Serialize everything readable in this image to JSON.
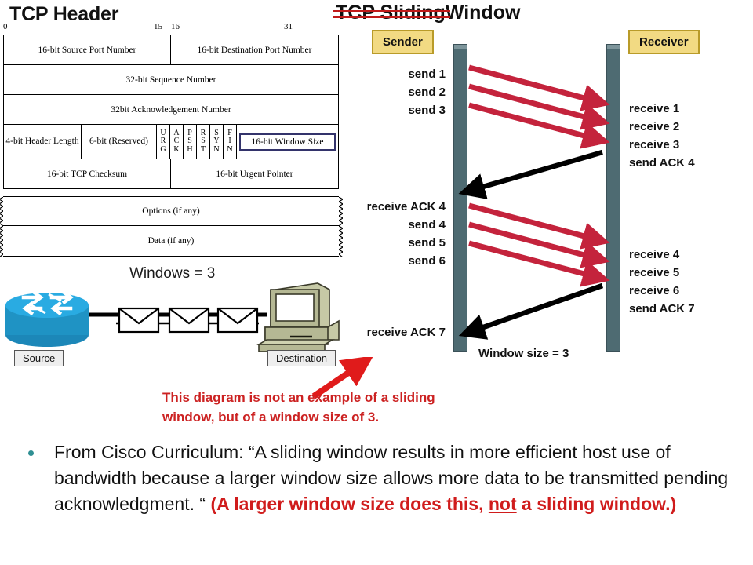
{
  "slide": {
    "left_title": "TCP Header",
    "right_title_struck": "TCP Sliding",
    "right_title_plain": "Window"
  },
  "tcp_header": {
    "bit_marks": [
      "0",
      "15",
      "16",
      "31"
    ],
    "rows": {
      "source_port": "16-bit Source Port Number",
      "dest_port": "16-bit Destination Port Number",
      "sequence": "32-bit Sequence Number",
      "acknowledgement": "32bit Acknowledgement Number",
      "header_length": "4-bit Header Length",
      "reserved": "6-bit (Reserved)",
      "flags": [
        "URG",
        "ACK",
        "PSH",
        "RST",
        "SYN",
        "FIN"
      ],
      "window_size": "16-bit Window Size",
      "checksum": "16-bit TCP Checksum",
      "urgent_pointer": "16-bit Urgent Pointer",
      "options": "Options (if any)",
      "data": "Data (if any)"
    },
    "highlight_color": "#33336b"
  },
  "network": {
    "windows_label": "Windows = 3",
    "source_label": "Source",
    "destination_label": "Destination",
    "packet_count": 3,
    "router_color": "#29abe2",
    "computer_color": "#b5b894"
  },
  "sliding_window": {
    "sender_label": "Sender",
    "receiver_label": "Receiver",
    "window_size_label": "Window size = 3",
    "sender_events": [
      "send 1",
      "send 2",
      "send 3",
      "receive ACK 4",
      "send 4",
      "send 5",
      "send 6",
      "receive ACK 7"
    ],
    "receiver_events": [
      "receive 1",
      "receive 2",
      "receive 3",
      "send ACK 4",
      "receive 4",
      "receive 5",
      "receive 6",
      "send ACK 7"
    ],
    "data_arrow_color": "#c4233c",
    "ack_arrow_color": "#000000",
    "box_fill": "#f2da83",
    "bar_color": "#4e6b72"
  },
  "callout": {
    "line1_a": "This diagram is ",
    "line1_u": "not",
    "line1_b": " an example of a sliding",
    "line2": "window, but of a window size of 3.",
    "color": "#cc2222"
  },
  "bullet": {
    "black_text": "From Cisco Curriculum: “A sliding window results in more efficient host use of bandwidth because a larger window size allows more data to be transmitted pending acknowledgment. “ ",
    "red_a": "(A larger window size does this, ",
    "red_u": "not",
    "red_b": " a sliding window.)",
    "bullet_color": "#2f8f93"
  }
}
